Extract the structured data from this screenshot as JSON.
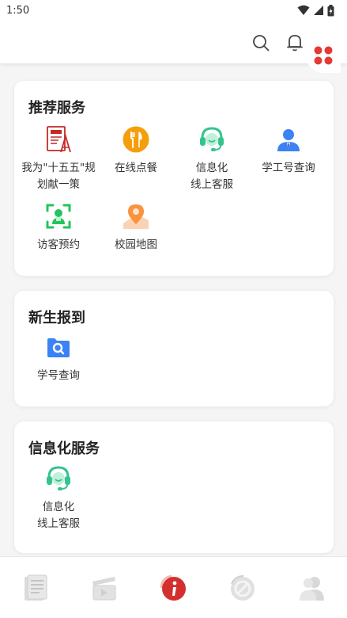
{
  "status_bar": {
    "time": "1:50"
  },
  "header": {
    "icons": [
      "search-icon",
      "bell-icon",
      "grid-menu-icon"
    ],
    "accent_color": "#e53935"
  },
  "sections": [
    {
      "title": "推荐服务",
      "items": [
        {
          "label": "我为\"十五五\"规\n划献一策",
          "icon": "document-icon",
          "color": "#c62828"
        },
        {
          "label": "在线点餐",
          "icon": "dining-icon",
          "color": "#f59e0b"
        },
        {
          "label": "信息化\n线上客服",
          "icon": "headset-icon",
          "color": "#34c38f"
        },
        {
          "label": "学工号查询",
          "icon": "user-badge-icon",
          "color": "#3b82f6"
        },
        {
          "label": "访客预约",
          "icon": "visitor-scan-icon",
          "color": "#22c55e"
        },
        {
          "label": "校园地图",
          "icon": "map-pin-icon",
          "color": "#fb923c"
        }
      ]
    },
    {
      "title": "新生报到",
      "items": [
        {
          "label": "学号查询",
          "icon": "search-folder-icon",
          "color": "#3b82f6"
        }
      ]
    },
    {
      "title": "信息化服务",
      "items": [
        {
          "label": "信息化\n线上客服",
          "icon": "headset-icon",
          "color": "#34c38f"
        }
      ]
    }
  ],
  "tabbar": {
    "tabs": [
      "news-icon",
      "video-icon",
      "info-icon",
      "forbidden-icon",
      "profile-icon"
    ],
    "active_index": 2,
    "active_color": "#d32f2f",
    "inactive_color": "#d9d9d9"
  }
}
